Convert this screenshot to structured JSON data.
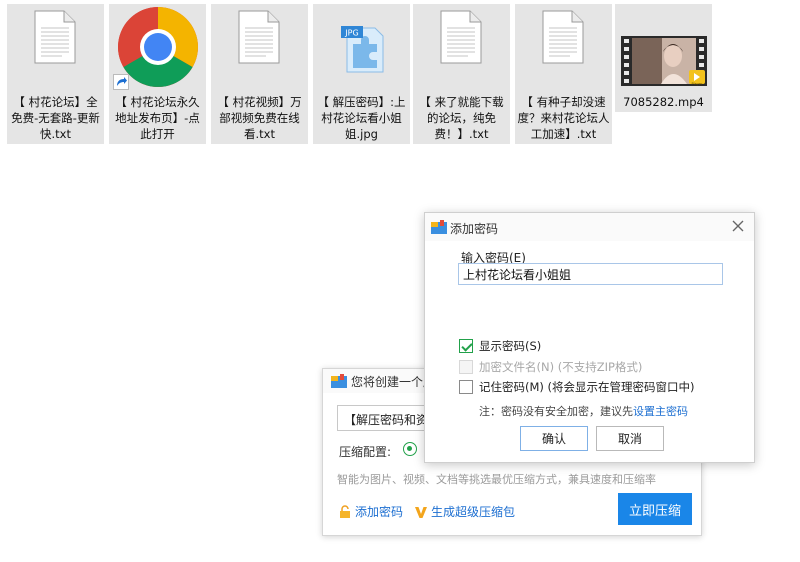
{
  "files": [
    {
      "name": "【 村花论坛】全免费-无套路-更新快.txt",
      "type": "txt"
    },
    {
      "name": "【 村花论坛永久地址发布页】-点此打开",
      "type": "chrome-shortcut"
    },
    {
      "name": "【 村花视频】万部视频免费在线看.txt",
      "type": "txt"
    },
    {
      "name": "【 解压密码】:上村花论坛看小姐姐.jpg",
      "type": "jpg"
    },
    {
      "name": "【 来了就能下载的论坛，纯免费！】.txt",
      "type": "txt"
    },
    {
      "name": "【 有种子却没速度？来村花论坛人工加速】.txt",
      "type": "txt"
    },
    {
      "name": "7085282.mp4",
      "type": "mp4"
    }
  ],
  "jpg_badge": "JPG",
  "player_badge": "Player",
  "compress_dialog": {
    "title": "您将创建一个压",
    "archive_name": "【解压密码和资源",
    "config_label": "压缩配置:",
    "hint": "智能为图片、视频、文档等挑选最优压缩方式，兼具速度和压缩率",
    "add_password": "添加密码",
    "super_pack": "生成超级压缩包",
    "compress_button": "立即压缩"
  },
  "password_dialog": {
    "title": "添加密码",
    "input_label": "输入密码(E)",
    "password_value": "上村花论坛看小姐姐",
    "show_password": {
      "label": "显示密码(S)",
      "checked": true
    },
    "encrypt_names": {
      "label": "加密文件名(N) (不支持ZIP格式)",
      "checked": false,
      "disabled": true
    },
    "remember_password": {
      "label": "记住密码(M) (将会显示在管理密码窗口中)",
      "checked": false
    },
    "note_prefix": "注：密码没有安全加密，建议先",
    "note_link": "设置主密码",
    "ok_button": "确认",
    "cancel_button": "取消"
  },
  "colors": {
    "accent_blue": "#1a86e8",
    "check_green": "#22a14a",
    "link_blue": "#1d6fd1"
  }
}
